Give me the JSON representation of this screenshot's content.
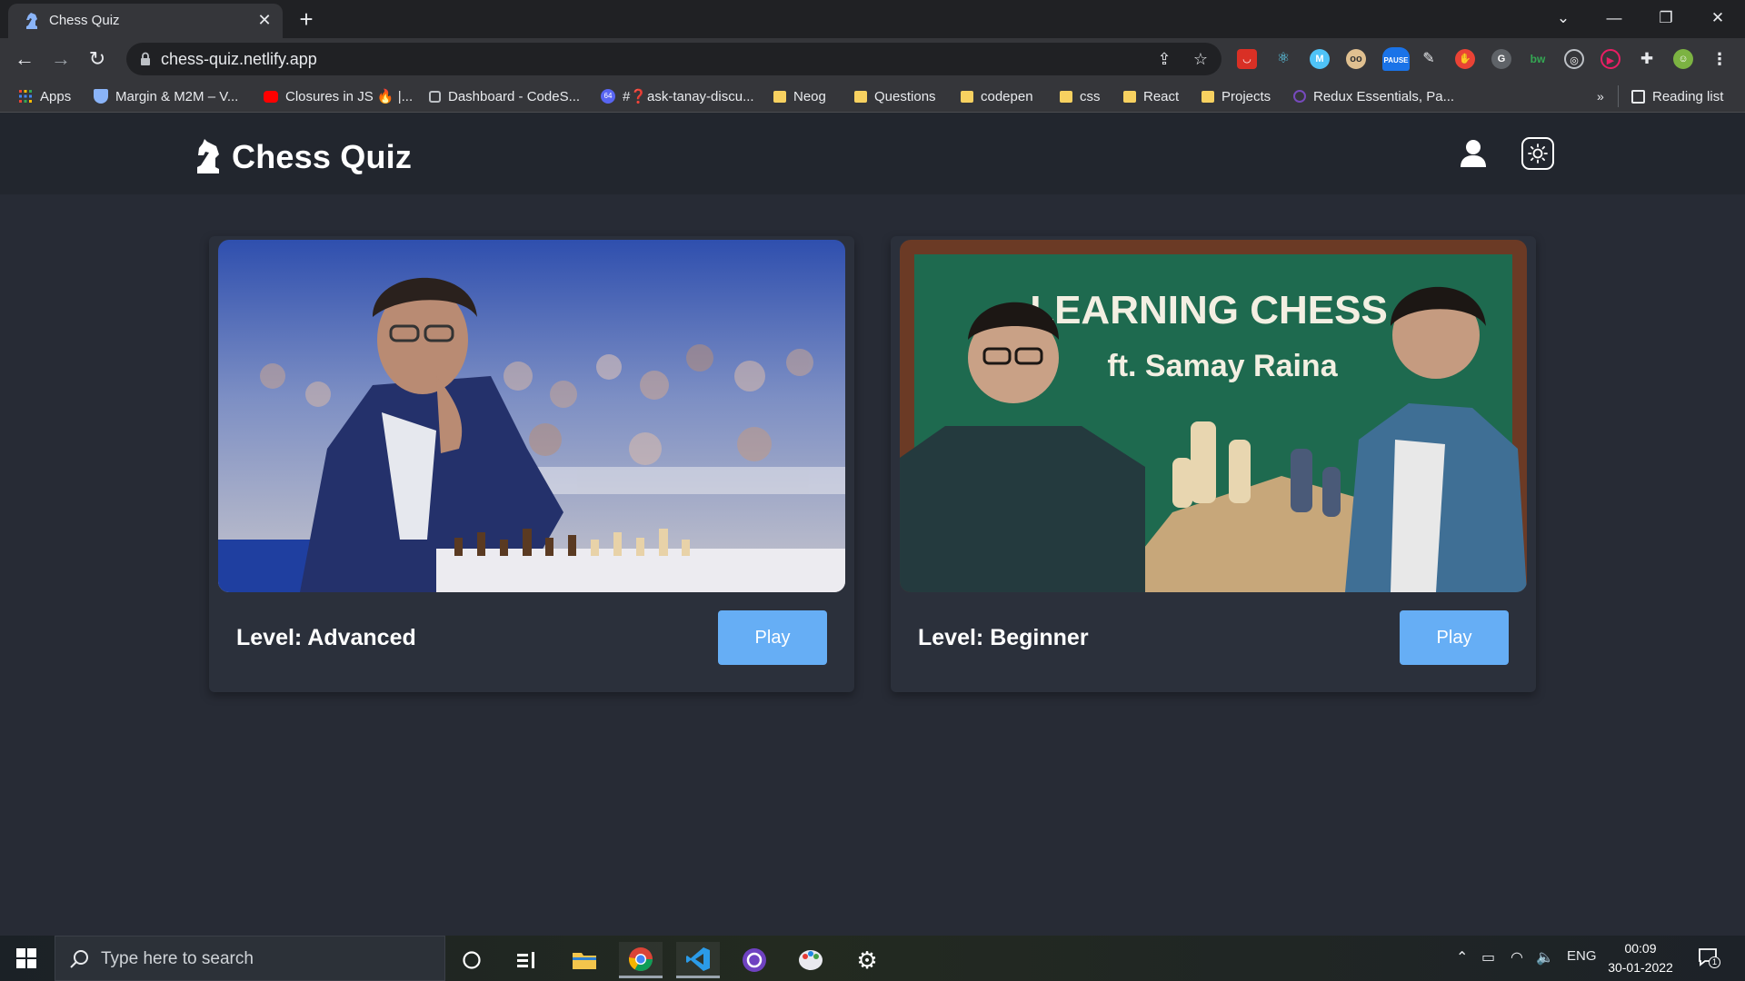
{
  "browser": {
    "tab_title": "Chess Quiz",
    "url": "chess-quiz.netlify.app",
    "extension_badge": "PAUSE",
    "reading_list": "Reading list",
    "bookmarks": [
      {
        "label": "Apps",
        "icon": "apps-grid-icon"
      },
      {
        "label": "Margin & M2M – V...",
        "icon": "shield-icon"
      },
      {
        "label": "Closures in JS 🔥 |...",
        "icon": "youtube-icon"
      },
      {
        "label": "Dashboard - CodeS...",
        "icon": "codesandbox-icon"
      },
      {
        "label": "#❓ask-tanay-discu...",
        "icon": "discord-icon",
        "badge": "64"
      },
      {
        "label": "Neog",
        "icon": "folder-icon"
      },
      {
        "label": "Questions",
        "icon": "folder-icon"
      },
      {
        "label": "codepen",
        "icon": "folder-icon"
      },
      {
        "label": "css",
        "icon": "folder-icon"
      },
      {
        "label": "React",
        "icon": "folder-icon"
      },
      {
        "label": "Projects",
        "icon": "folder-icon"
      },
      {
        "label": "Redux Essentials, Pa...",
        "icon": "redux-icon"
      }
    ],
    "more_bookmarks": "»"
  },
  "app": {
    "brand": "Chess Quiz",
    "cards": [
      {
        "level": "Level: Advanced",
        "play_label": "Play",
        "image_desc": "Player thinking at a chess tournament"
      },
      {
        "level": "Level: Beginner",
        "play_label": "Play",
        "image_title": "LEARNING CHESS",
        "image_subtitle": "ft. Samay Raina"
      }
    ],
    "accent_color": "#66aef5"
  },
  "taskbar": {
    "search_placeholder": "Type here to search",
    "language": "ENG",
    "time": "00:09",
    "date": "30-01-2022",
    "notification_count": "1"
  }
}
